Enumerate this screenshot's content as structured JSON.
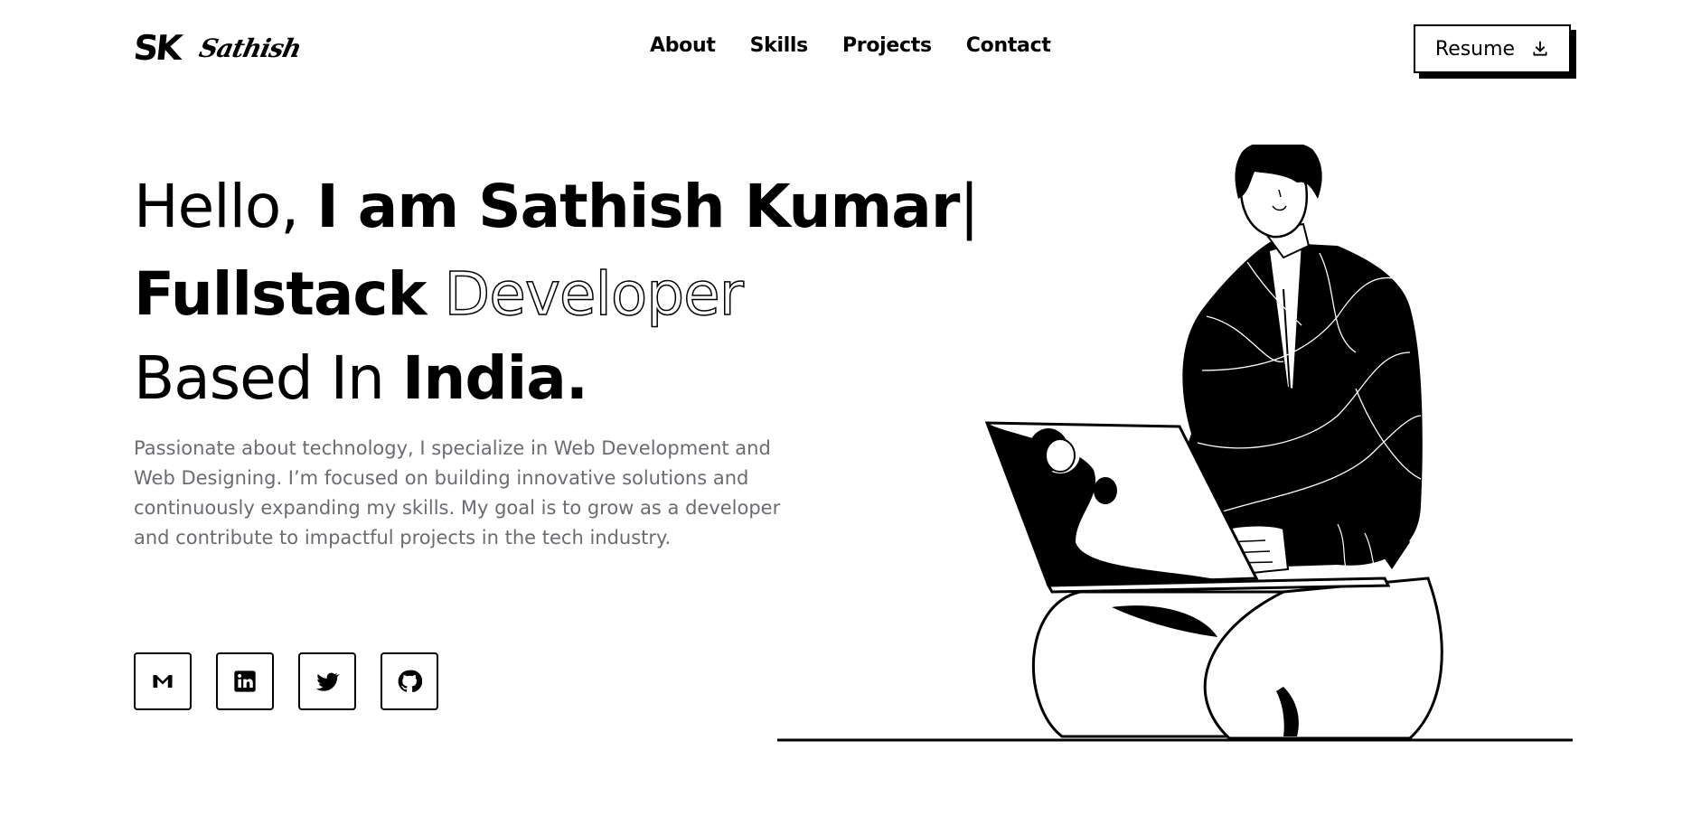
{
  "header": {
    "logo_mark": "SK",
    "logo_name": "Sathish",
    "nav": [
      "About",
      "Skills",
      "Projects",
      "Contact"
    ],
    "resume_label": "Resume"
  },
  "hero": {
    "line1": {
      "hello": "Hello,",
      "name": "I am Sathish Kumar",
      "cursor": "|"
    },
    "line2": {
      "role": "Fullstack",
      "outline": "Developer"
    },
    "line3": {
      "based": "Based In",
      "country": "India."
    },
    "bio": "Passionate about technology, I specialize in Web Development and Web Designing. I’m focused on building innovative solutions and continuously expanding my skills. My goal is to grow as a developer and contribute to impactful projects in the tech industry."
  },
  "socials": [
    {
      "icon": "gmail-icon"
    },
    {
      "icon": "linkedin-icon"
    },
    {
      "icon": "twitter-icon"
    },
    {
      "icon": "github-icon"
    }
  ],
  "colors": {
    "text": "#000000",
    "muted": "#6b6b72",
    "background": "#ffffff"
  }
}
